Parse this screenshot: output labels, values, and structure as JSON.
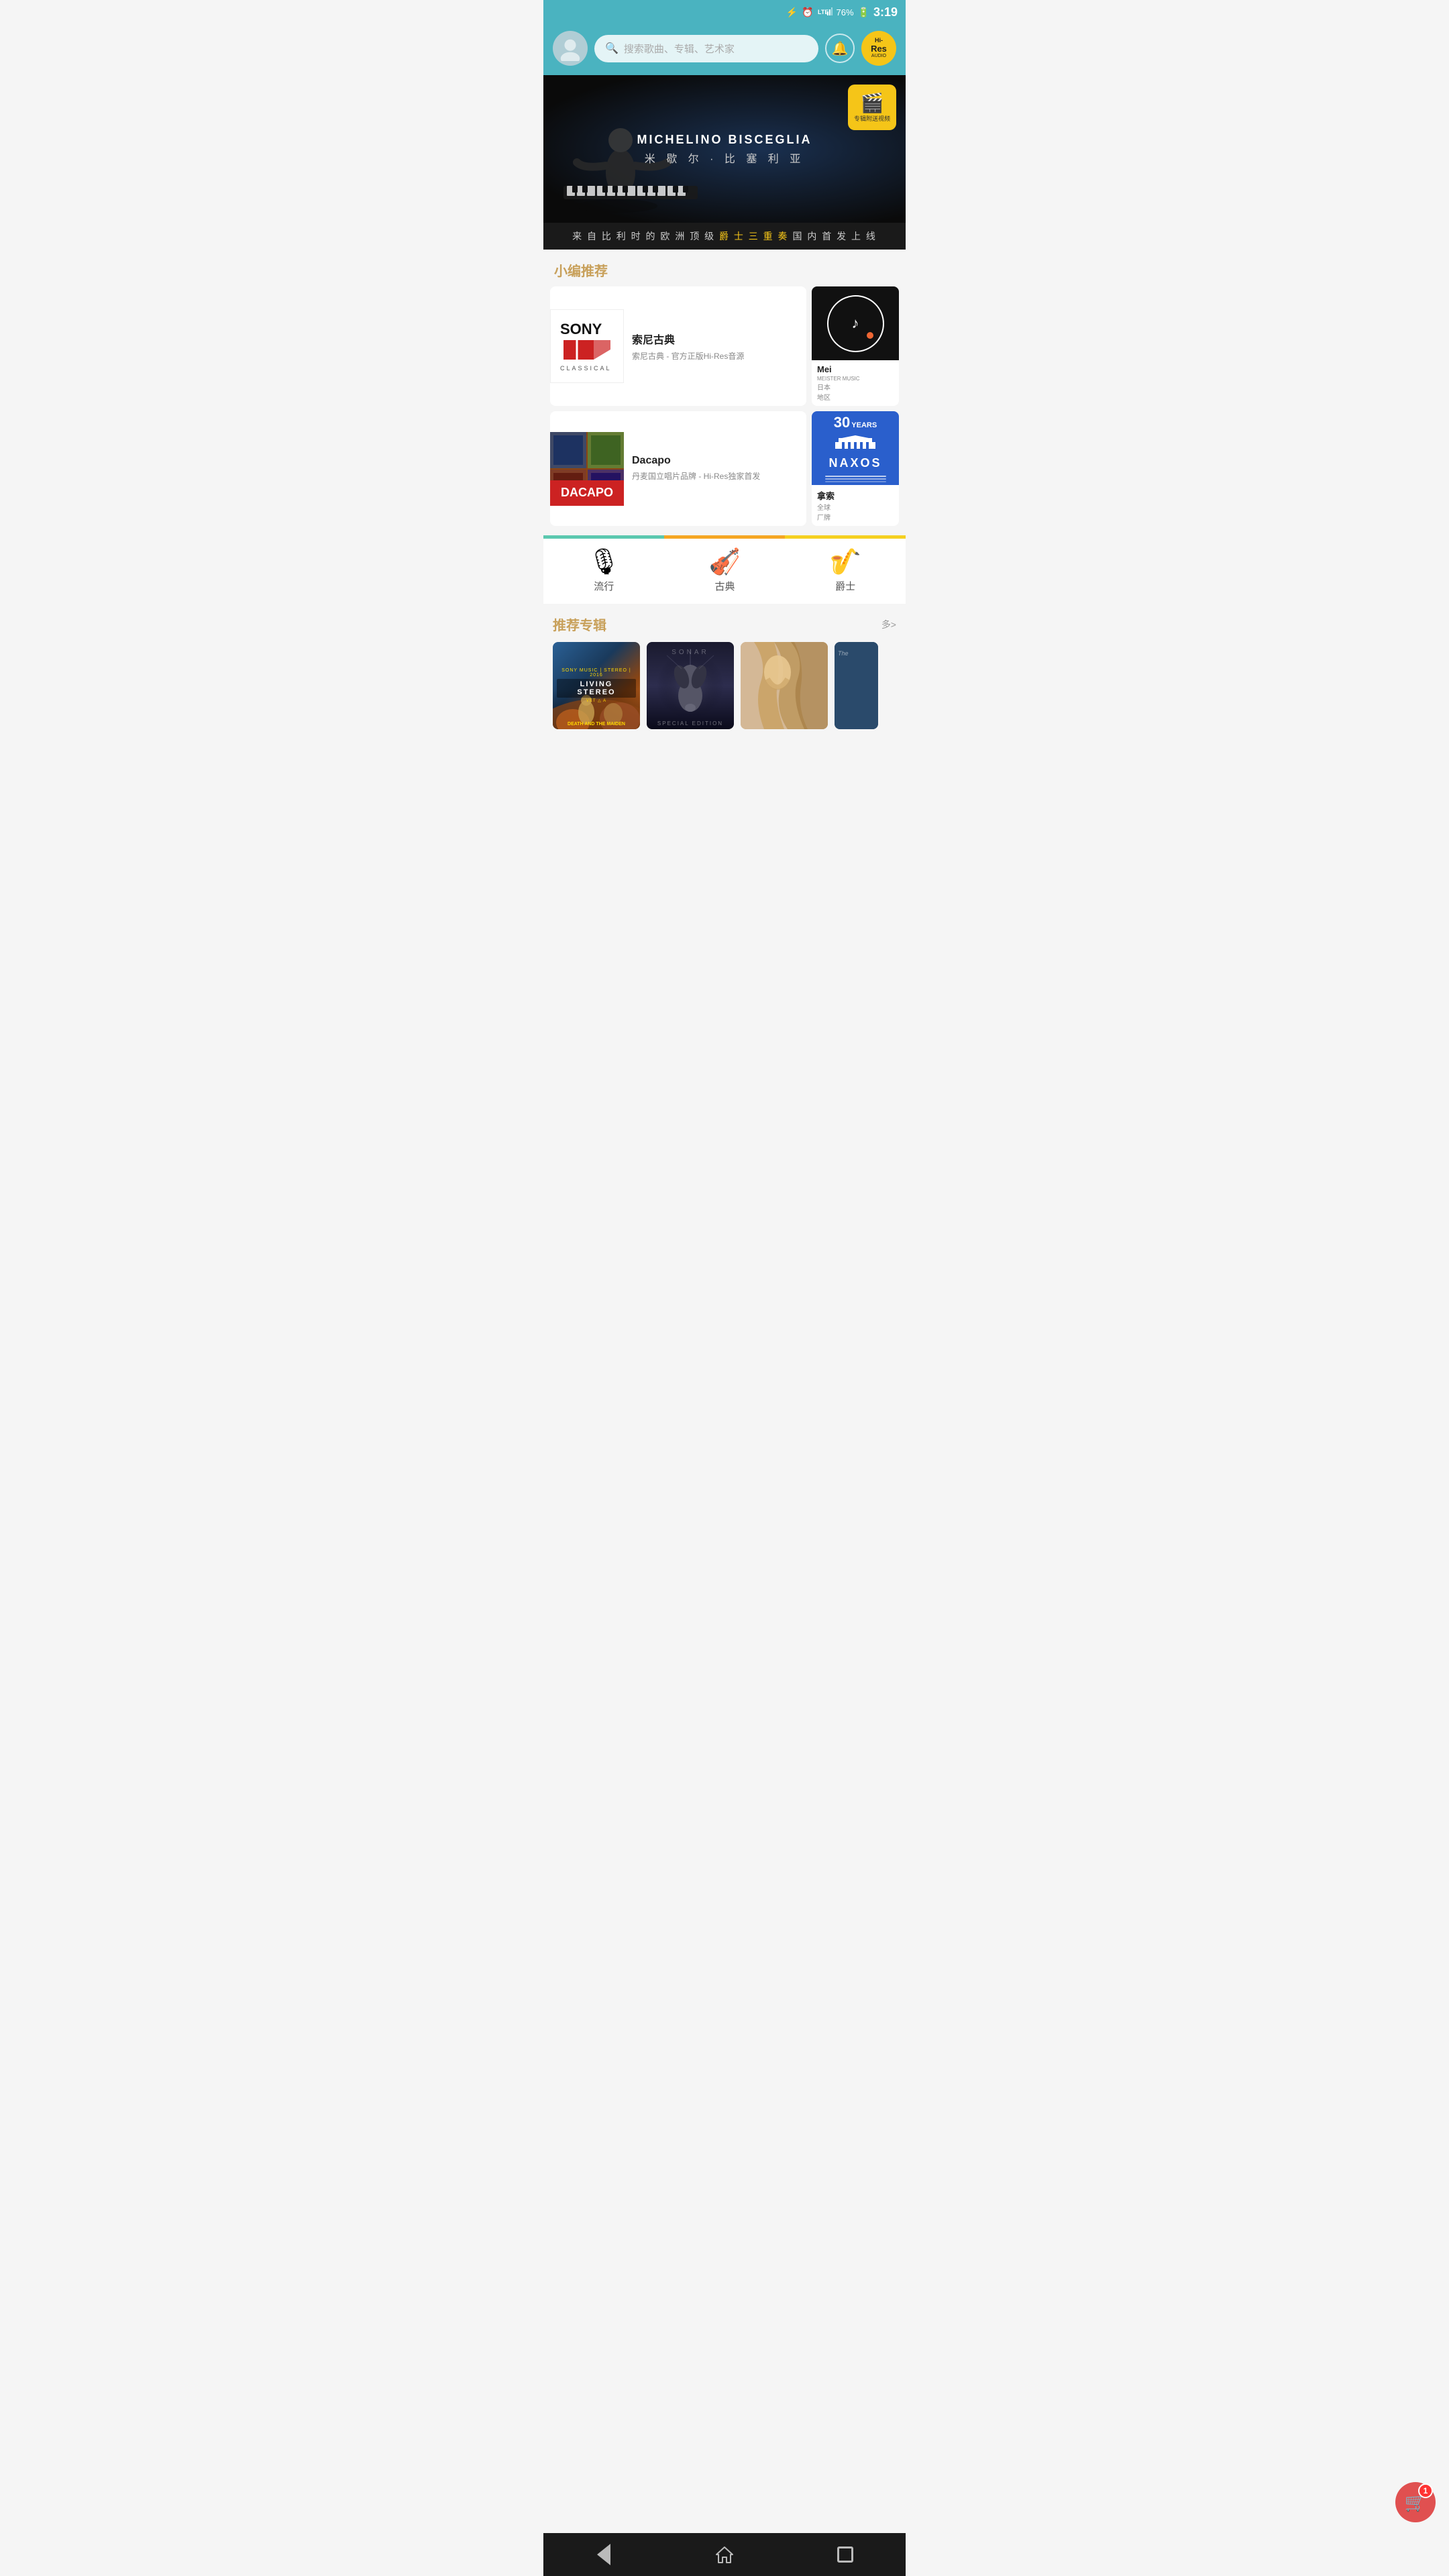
{
  "statusBar": {
    "time": "3:19",
    "battery": "76%",
    "signal": "LTE"
  },
  "header": {
    "searchPlaceholder": "搜索歌曲、专辑、艺术家",
    "hiresLabel": "Hi-Res",
    "audioLabel": "AUDIO"
  },
  "banner": {
    "artistEn": "MICHELINO BISCEGLIA",
    "artistCn": "米 歇 尔 · 比 塞 利 亚",
    "videoLabel": "专辑附送视频",
    "subtitle1": "来 自 比 利 时 的 欧 洲 顶 级",
    "subtitleHighlight": "爵 士 三 重 奏",
    "subtitle2": "国 内 首 发 上 线"
  },
  "recommendations": {
    "sectionTitle": "小编推荐",
    "items": [
      {
        "name": "索尼古典",
        "desc": "索尼古典 - 官方正版Hi-Res音源",
        "logo": "SONY_CLASSICAL"
      },
      {
        "name": "Mei",
        "desc": "日本\n地区",
        "logo": "MEISTER_MUSIC"
      },
      {
        "name": "Dacapo",
        "desc": "丹麦国立唱片品牌 - Hi-Res独家首发",
        "logo": "DACAPO"
      },
      {
        "name": "拿索",
        "desc": "全球\n厂牌",
        "logo": "NAXOS"
      }
    ]
  },
  "genres": [
    {
      "icon": "🎙",
      "label": "流行"
    },
    {
      "icon": "🎻",
      "label": "古典"
    },
    {
      "icon": "🎷",
      "label": "爵士"
    }
  ],
  "albums": {
    "sectionTitle": "推荐专辑",
    "moreLabel": "多>",
    "items": [
      {
        "title": "LIVING STEREO",
        "subtitle": "DEATH AND THE MAIDEN"
      },
      {
        "title": "SONAR",
        "subtitle": ""
      },
      {
        "title": "",
        "subtitle": ""
      },
      {
        "title": "The...",
        "subtitle": ""
      }
    ]
  },
  "cart": {
    "count": "1"
  },
  "nav": {
    "back": "◁",
    "home": "⌂",
    "recent": "□"
  }
}
